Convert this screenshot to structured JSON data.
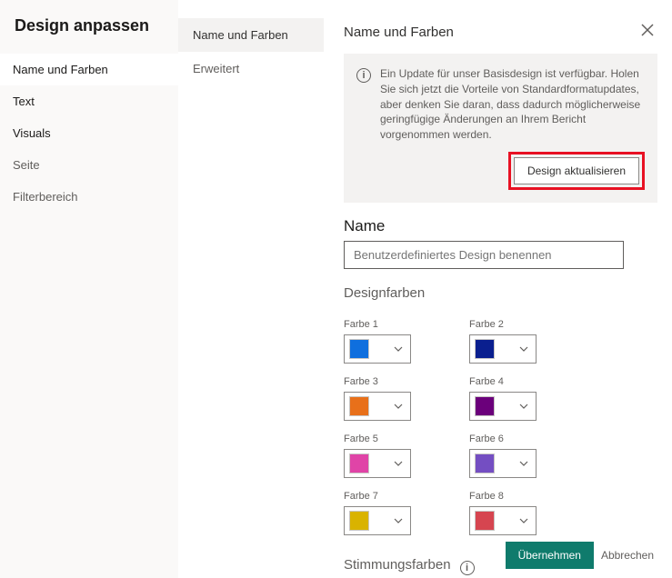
{
  "sidebar": {
    "title": "Design anpassen",
    "items": [
      {
        "label": "Name und Farben"
      },
      {
        "label": "Text"
      },
      {
        "label": "Visuals"
      },
      {
        "label": "Seite"
      },
      {
        "label": "Filterbereich"
      }
    ]
  },
  "tabs": {
    "items": [
      {
        "label": "Name und Farben"
      },
      {
        "label": "Erweitert"
      }
    ]
  },
  "panel": {
    "title": "Name und Farben",
    "info_text": "Ein Update für unser Basisdesign ist verfügbar. Holen Sie sich jetzt die Vorteile von Standardformatupdates, aber denken Sie daran, dass dadurch möglicherweise geringfügige Änderungen an Ihrem Bericht vorgenommen werden.",
    "update_button": "Design aktualisieren",
    "name_label": "Name",
    "name_placeholder": "Benutzerdefiniertes Design benennen",
    "design_colors_label": "Designfarben",
    "swatches": [
      {
        "label": "Farbe 1",
        "color": "#0f6fde"
      },
      {
        "label": "Farbe 2",
        "color": "#0a1f8f"
      },
      {
        "label": "Farbe 3",
        "color": "#e8701a"
      },
      {
        "label": "Farbe 4",
        "color": "#6b007b"
      },
      {
        "label": "Farbe 5",
        "color": "#e044a7"
      },
      {
        "label": "Farbe 6",
        "color": "#744ec2"
      },
      {
        "label": "Farbe 7",
        "color": "#d9b300"
      },
      {
        "label": "Farbe 8",
        "color": "#d64550"
      }
    ],
    "mood_label": "Stimmungsfarben"
  },
  "footer": {
    "apply": "Übernehmen",
    "cancel": "Abbrechen"
  }
}
